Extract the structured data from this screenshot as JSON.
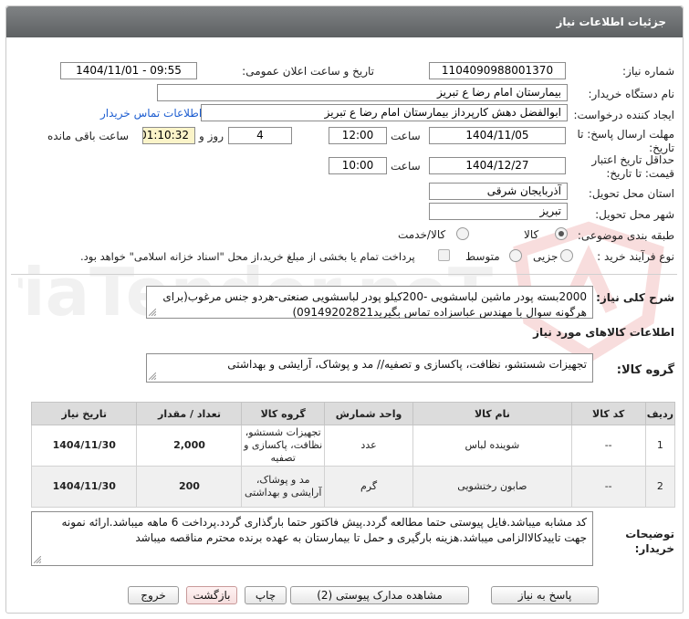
{
  "header": {
    "title": "جزئیات اطلاعات نیاز"
  },
  "form": {
    "need_number_label": "شماره نیاز:",
    "need_number": "1104090988001370",
    "announce_label": "تاریخ و ساعت اعلان عمومی:",
    "announce_value": "1404/11/01 - 09:55",
    "buyer_label": "نام دستگاه خریدار:",
    "buyer_value": "بیمارستان امام رضا  ع  تبریز",
    "creator_label": "ایجاد کننده درخواست:",
    "creator_value": "ابوالفضل دهش کارپرداز بیمارستان امام رضا  ع  تبریز",
    "contact_link": "اطلاعات تماس خریدار",
    "deadline_label_1": "مهلت ارسال پاسخ: تا",
    "deadline_label_2": "تاریخ:",
    "deadline_date": "1404/11/05",
    "time_label": "ساعت",
    "deadline_time": "12:00",
    "days_value": "4",
    "days_label": "روز و",
    "remaining_time": "01:10:32",
    "remaining_label": "ساعت باقی مانده",
    "validity_label_1": "حداقل تاریخ اعتبار",
    "validity_label_2": "قیمت: تا تاریخ:",
    "validity_date": "1404/12/27",
    "validity_time_label": "ساعت",
    "validity_time": "10:00",
    "province_label": "استان محل تحویل:",
    "province_value": "آذربایجان شرقی",
    "city_label": "شهر محل تحویل:",
    "city_value": "تبریز",
    "category_label": "طبقه بندی موضوعی:",
    "category_goods": "کالا",
    "category_goods_service": "کالا/خدمت",
    "process_label": "نوع فرآیند خرید :",
    "process_minor": "جزیی",
    "process_medium": "متوسط",
    "process_note": "پرداخت تمام یا بخشی از مبلغ خرید،از محل \"اسناد خزانه اسلامی\" خواهد بود."
  },
  "description": {
    "label": "شرح کلی نیاز:",
    "text": "2000بسته پودر ماشین لباسشویی -200کیلو پودر لباسشویی صنعتی-هردو جنس مرغوب(برای هرگونه سوال با مهندس عباسزاده تماس بگیرید09149202821)"
  },
  "goods_section": {
    "title": "اطلاعات کالاهای مورد نیاز",
    "group_label": "گروه کالا:",
    "group_value": "تجهیزات شستشو، نظافت، پاکسازی و تصفیه// مد و پوشاک، آرایشی و بهداشتی"
  },
  "table": {
    "headers": [
      "ردیف",
      "کد کالا",
      "نام کالا",
      "واحد شمارش",
      "گروه کالا",
      "تعداد / مقدار",
      "تاریخ نیاز"
    ],
    "rows": [
      {
        "index": "1",
        "code": "--",
        "name": "شوینده لباس",
        "unit": "عدد",
        "group": "تجهیزات شستشو، نظافت، پاکسازی و تصفیه",
        "qty": "2,000",
        "date": "1404/11/30"
      },
      {
        "index": "2",
        "code": "--",
        "name": "صابون رختشویی",
        "unit": "گرم",
        "group": "مد و پوشاک، آرایشی و بهداشتی",
        "qty": "200",
        "date": "1404/11/30"
      }
    ]
  },
  "buyer_notes": {
    "label_1": "توضیحات",
    "label_2": "خریدار:",
    "text": "کد مشابه میباشد.فایل پیوستی حتما مطالعه گردد.پیش فاکتور حتما بارگذاری گردد.پرداخت 6 ماهه میباشد.ارائه نمونه جهت تاییدکالاالزامی میباشد.هزینه بارگیری و حمل تا بیمارستان به عهده برنده محترم مناقصه میباشد"
  },
  "buttons": {
    "reply": "پاسخ به نیاز",
    "attachments": "مشاهده مدارک پیوستی (2)",
    "print": "چاپ",
    "back": "بازگشت",
    "exit": "خروج"
  },
  "watermark": {
    "text": "AriaTender.neT"
  },
  "colors": {
    "header_bg": "#6e7173",
    "link": "#1f5fd1",
    "highlight": "#fbf4c9",
    "table_header": "#dcdcdc"
  }
}
